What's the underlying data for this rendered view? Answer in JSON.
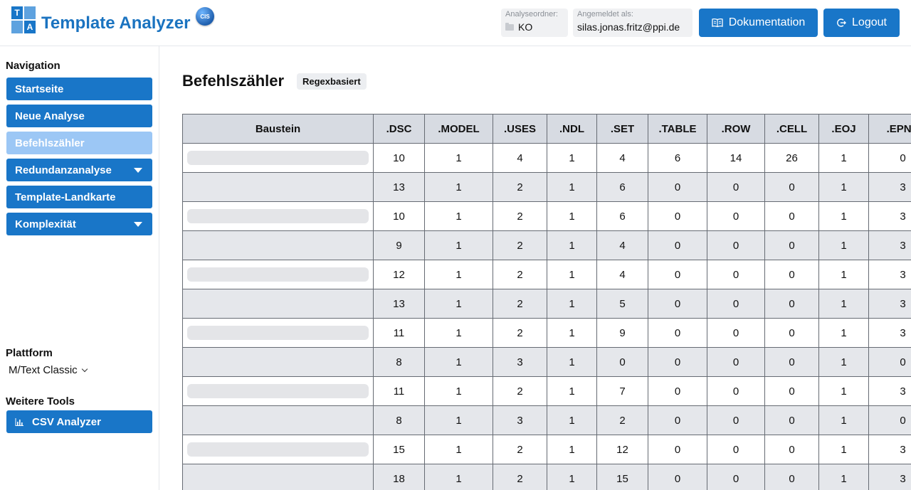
{
  "header": {
    "logo_letters": [
      "T",
      "A"
    ],
    "app_title": "Template Analyzer",
    "cis_badge": "CIS",
    "folder_label": "Analyseordner:",
    "folder_value": "KO",
    "user_label": "Angemeldet als:",
    "user_value": "silas.jonas.fritz@ppi.de",
    "doc_button": "Dokumentation",
    "logout_button": "Logout"
  },
  "sidebar": {
    "nav_heading": "Navigation",
    "items": [
      {
        "label": "Startseite"
      },
      {
        "label": "Neue Analyse"
      },
      {
        "label": "Befehlszähler"
      },
      {
        "label": "Redundanzanalyse"
      },
      {
        "label": "Template-Landkarte"
      },
      {
        "label": "Komplexität"
      }
    ],
    "platform_heading": "Plattform",
    "platform_value": "M/Text Classic",
    "tools_heading": "Weitere Tools",
    "csv_button": "CSV Analyzer"
  },
  "main": {
    "title": "Befehlszähler",
    "badge": "Regexbasiert",
    "table": {
      "headers": [
        "Baustein",
        ".DSC",
        ".MODEL",
        ".USES",
        ".NDL",
        ".SET",
        ".TABLE",
        ".ROW",
        ".CELL",
        ".EOJ",
        ".EPNA"
      ],
      "rows": [
        [
          "10",
          "1",
          "4",
          "1",
          "4",
          "6",
          "14",
          "26",
          "1",
          "0"
        ],
        [
          "13",
          "1",
          "2",
          "1",
          "6",
          "0",
          "0",
          "0",
          "1",
          "3"
        ],
        [
          "10",
          "1",
          "2",
          "1",
          "6",
          "0",
          "0",
          "0",
          "1",
          "3"
        ],
        [
          "9",
          "1",
          "2",
          "1",
          "4",
          "0",
          "0",
          "0",
          "1",
          "3"
        ],
        [
          "12",
          "1",
          "2",
          "1",
          "4",
          "0",
          "0",
          "0",
          "1",
          "3"
        ],
        [
          "13",
          "1",
          "2",
          "1",
          "5",
          "0",
          "0",
          "0",
          "1",
          "3"
        ],
        [
          "11",
          "1",
          "2",
          "1",
          "9",
          "0",
          "0",
          "0",
          "1",
          "3"
        ],
        [
          "8",
          "1",
          "3",
          "1",
          "0",
          "0",
          "0",
          "0",
          "1",
          "0"
        ],
        [
          "11",
          "1",
          "2",
          "1",
          "7",
          "0",
          "0",
          "0",
          "1",
          "3"
        ],
        [
          "8",
          "1",
          "3",
          "1",
          "2",
          "0",
          "0",
          "0",
          "1",
          "0"
        ],
        [
          "15",
          "1",
          "2",
          "1",
          "12",
          "0",
          "0",
          "0",
          "1",
          "3"
        ],
        [
          "18",
          "1",
          "2",
          "1",
          "15",
          "0",
          "0",
          "0",
          "1",
          "3"
        ]
      ]
    }
  },
  "colors": {
    "primary": "#1976c8",
    "active_nav": "#9cc7f5",
    "table_header_bg": "#d7dbe2",
    "row_alt_bg": "#e5e7eb"
  },
  "icons": {
    "doc_button": "book-icon",
    "logout_button": "logout-icon",
    "csv_button": "bar-chart-icon",
    "folder": "folder-icon"
  }
}
